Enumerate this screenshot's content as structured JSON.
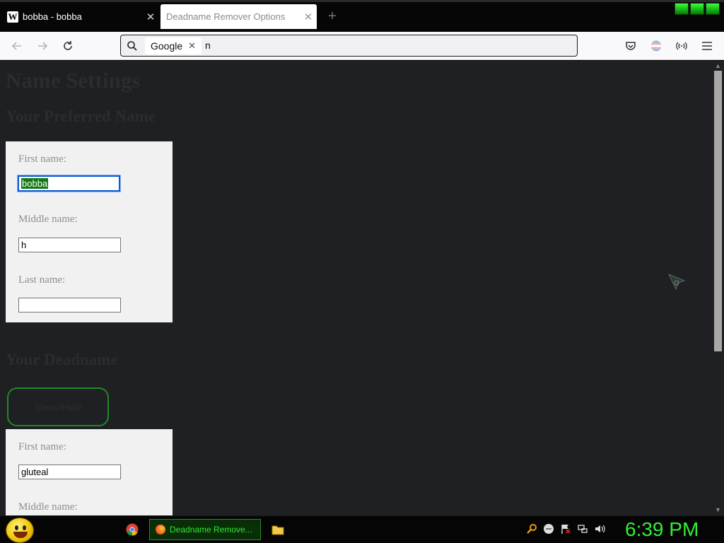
{
  "browser": {
    "tabs": [
      {
        "favicon": "W",
        "title": "bobba - bobba",
        "close": "✕"
      },
      {
        "title": "Deadname Remover Options",
        "close": "✕"
      }
    ],
    "new_tab": "+",
    "search_engine": "Google",
    "search_engine_clear": "✕",
    "url_text": "n"
  },
  "page": {
    "title": "Name Settings",
    "preferred_heading": "Your Preferred Name",
    "preferred": {
      "first_label": "First name:",
      "first_value": "bobba",
      "middle_label": "Middle name:",
      "middle_value": "h",
      "last_label": "Last name:",
      "last_value": ""
    },
    "deadname_heading": "Your Deadname",
    "toggle_label": "Show/Hide",
    "deadname": {
      "first_label": "First name:",
      "first_value": "gluteal",
      "middle_label": "Middle name:"
    }
  },
  "taskbar": {
    "task_label": "Deadname Remove...",
    "clock": "6:39 PM"
  },
  "colors": {
    "page_bg": "#1e2024",
    "card_bg": "#f1f1f1",
    "accent_green": "#33ee33",
    "selection_green": "#137a13",
    "focus_blue": "#0b5bd3"
  }
}
